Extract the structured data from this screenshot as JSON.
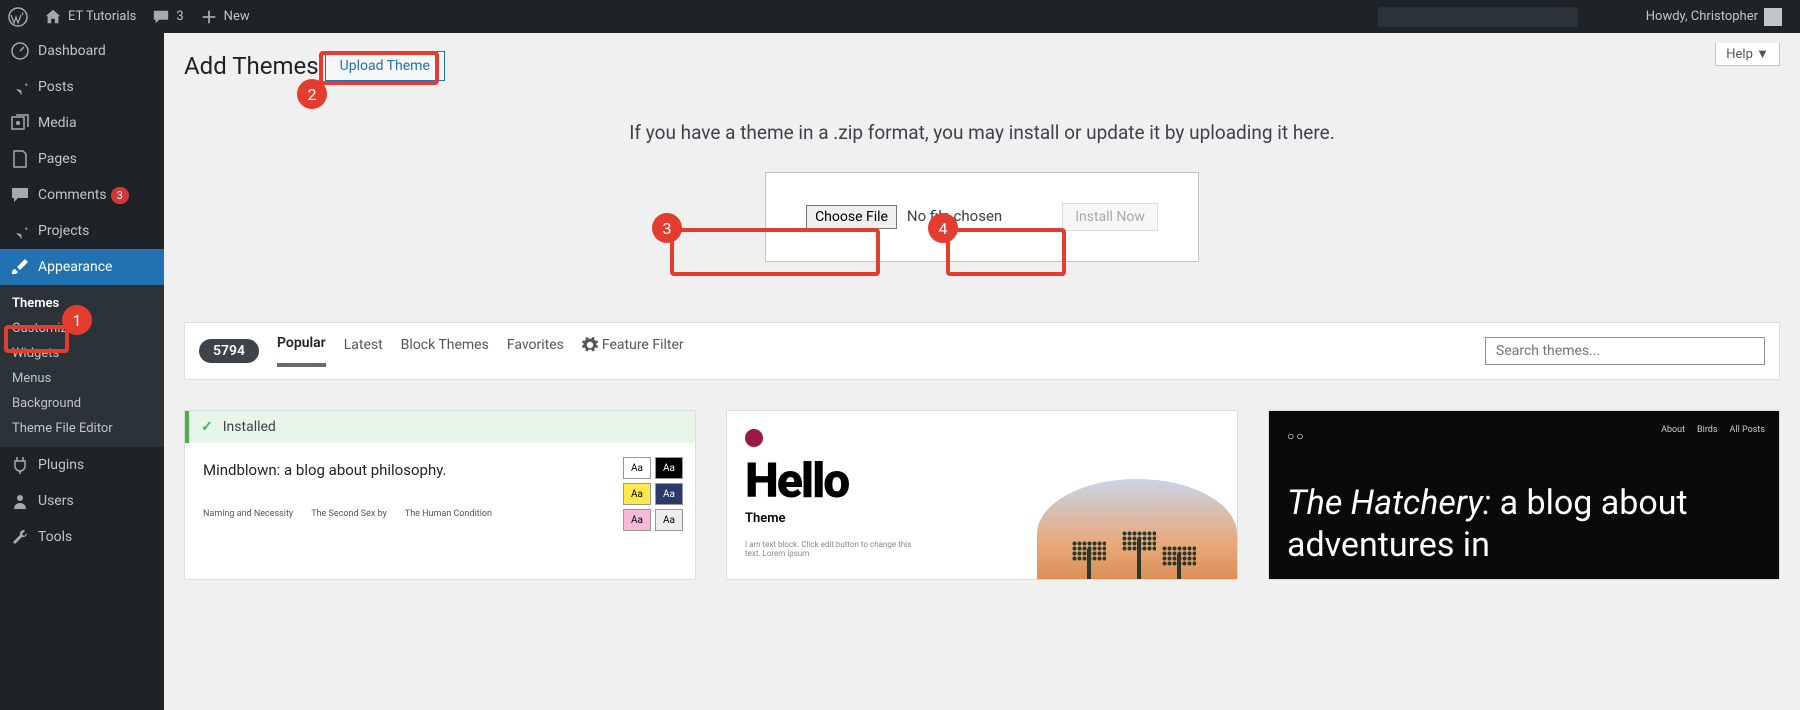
{
  "adminbar": {
    "site_name": "ET Tutorials",
    "comments_count": "3",
    "new_label": "New",
    "howdy": "Howdy, Christopher"
  },
  "sidebar": {
    "dashboard": "Dashboard",
    "posts": "Posts",
    "media": "Media",
    "pages": "Pages",
    "comments": "Comments",
    "comments_count": "3",
    "projects": "Projects",
    "appearance": "Appearance",
    "sub": {
      "themes": "Themes",
      "customize": "Customize",
      "widgets": "Widgets",
      "menus": "Menus",
      "background": "Background",
      "theme_file_editor": "Theme File Editor"
    },
    "plugins": "Plugins",
    "users": "Users",
    "tools": "Tools"
  },
  "page": {
    "help": "Help ▼",
    "title": "Add Themes",
    "upload_button": "Upload Theme",
    "upload_text": "If you have a theme in a .zip format, you may install or update it by uploading it here.",
    "choose_file": "Choose File",
    "no_file": "No file chosen",
    "install_now": "Install Now"
  },
  "filter": {
    "count": "5794",
    "popular": "Popular",
    "latest": "Latest",
    "block_themes": "Block Themes",
    "favorites": "Favorites",
    "feature_filter": "Feature Filter",
    "search_placeholder": "Search themes..."
  },
  "themes": {
    "installed_label": "Installed",
    "card1_title": "Mindblown: a blog about philosophy.",
    "card1_col1": "Naming and Necessity",
    "card1_col2": "The Second Sex by",
    "card1_col3": "The Human Condition",
    "swatch_label": "Aa",
    "hello_title": "Hello",
    "hello_sub": "Theme",
    "hello_lorem": "I am text block. Click edit button to change this text. Lorem ipsum",
    "hatchery_logo": "○○",
    "hatchery_nav1": "About",
    "hatchery_nav2": "Birds",
    "hatchery_nav3": "All Posts",
    "hatchery_title_em": "The Hatchery:",
    "hatchery_title_rest": "a blog about adventures in"
  },
  "callouts": {
    "n1": "1",
    "n2": "2",
    "n3": "3",
    "n4": "4"
  }
}
